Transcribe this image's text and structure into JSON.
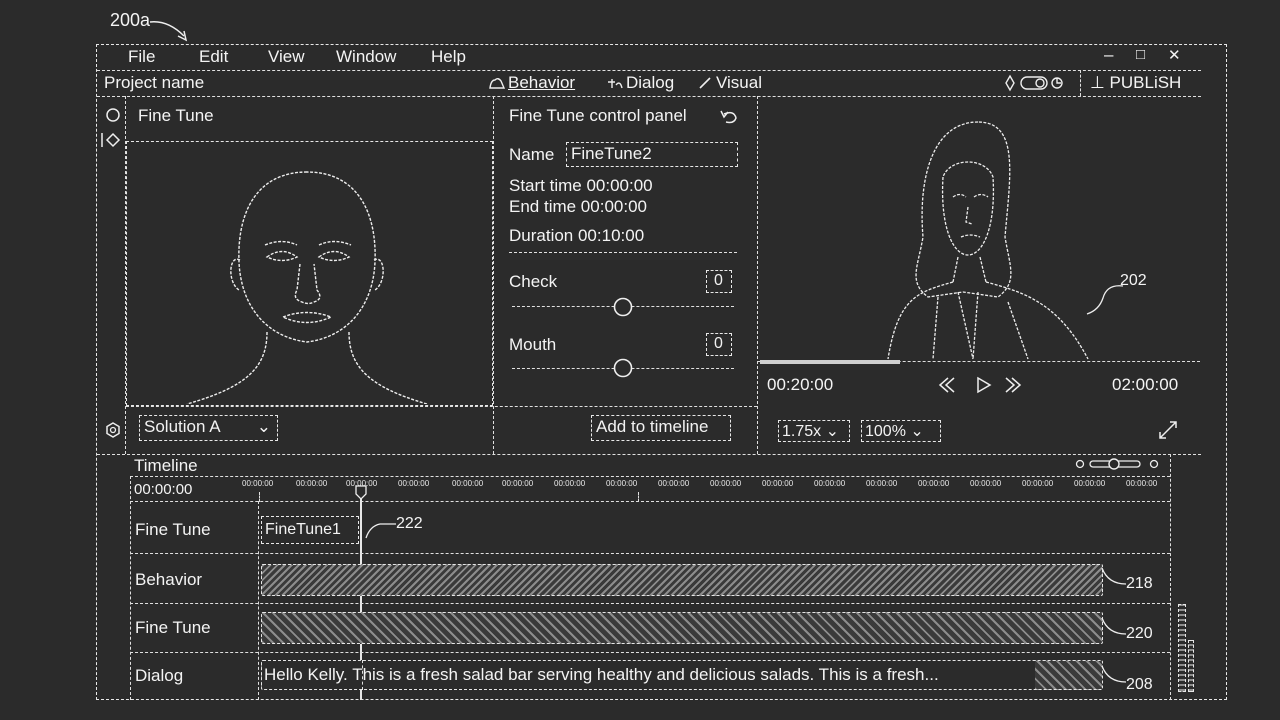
{
  "figure_label": "200a",
  "menu": [
    "File",
    "Edit",
    "View",
    "Window",
    "Help"
  ],
  "window_controls": [
    "–",
    "□",
    "✕"
  ],
  "project_name": "Project name",
  "modes": {
    "behavior": "Behavior",
    "dialog": "Dialog",
    "visual": "Visual"
  },
  "publish_label": "⊥ PUBLiSH",
  "fine_tune_title": "Fine Tune",
  "control_panel": {
    "title": "Fine Tune control panel",
    "name_label": "Name",
    "name_value": "FineTune2",
    "start_time": "Start time 00:00:00",
    "end_time": "End time 00:00:00",
    "duration": "Duration 00:10:00",
    "check_label": "Check",
    "check_value": "0",
    "mouth_label": "Mouth",
    "mouth_value": "0"
  },
  "solution_select": "Solution A",
  "add_timeline": "Add to timeline",
  "preview": {
    "ref": "202",
    "time_current": "00:20:00",
    "time_total": "02:00:00",
    "speed": "1.75x",
    "zoom": "100%"
  },
  "timeline": {
    "title": "Timeline",
    "current_time": "00:00:00",
    "ticks": [
      "00:00:00",
      "00:00:00",
      "00:00:00",
      "00:00:00",
      "00:00:00",
      "00:00:00",
      "00:00:00",
      "00:00:00",
      "00:00:00",
      "00:00:00",
      "00:00:00",
      "00:00:00",
      "00:00:00",
      "00:00:00",
      "00:00:00",
      "00:00:00",
      "00:00:00",
      "00:00:00"
    ],
    "tracks": [
      {
        "label": "Fine Tune",
        "clip": "FineTune1",
        "ref": "222"
      },
      {
        "label": "Behavior",
        "clip": "",
        "ref": "218"
      },
      {
        "label": "Fine Tune",
        "clip": "",
        "ref": "220"
      },
      {
        "label": "Dialog",
        "clip": "Hello Kelly. This is a fresh salad bar serving healthy and delicious salads. This is a fresh...",
        "ref": "208"
      }
    ]
  }
}
